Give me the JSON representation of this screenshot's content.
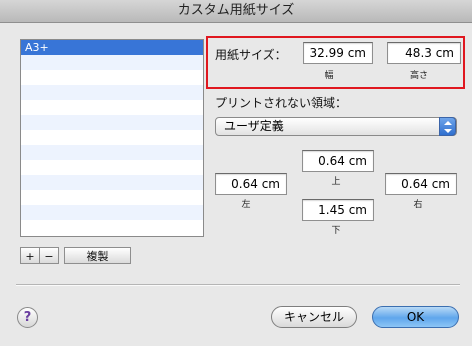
{
  "window": {
    "title": "カスタム用紙サイズ"
  },
  "paper_list": {
    "items": [
      "A3+"
    ],
    "selected": "A3+"
  },
  "paper_size": {
    "label": "用紙サイズ：",
    "width": {
      "value": "32.99 cm",
      "caption": "幅"
    },
    "height": {
      "value": "48.3 cm",
      "caption": "高さ"
    }
  },
  "margins": {
    "label": "プリントされない領域：",
    "preset": {
      "selected": "ユーザ定義"
    },
    "top": {
      "value": "0.64 cm",
      "caption": "上"
    },
    "left": {
      "value": "0.64 cm",
      "caption": "左"
    },
    "right": {
      "value": "0.64 cm",
      "caption": "右"
    },
    "bottom": {
      "value": "1.45 cm",
      "caption": "下"
    }
  },
  "list_buttons": {
    "add": "+",
    "remove": "−",
    "duplicate": "複製"
  },
  "footer": {
    "help": "?",
    "cancel": "キャンセル",
    "ok": "OK"
  },
  "colors": {
    "highlight": "#e0171f",
    "selection": "#3875d7",
    "default_button": "#5fa6ec"
  }
}
